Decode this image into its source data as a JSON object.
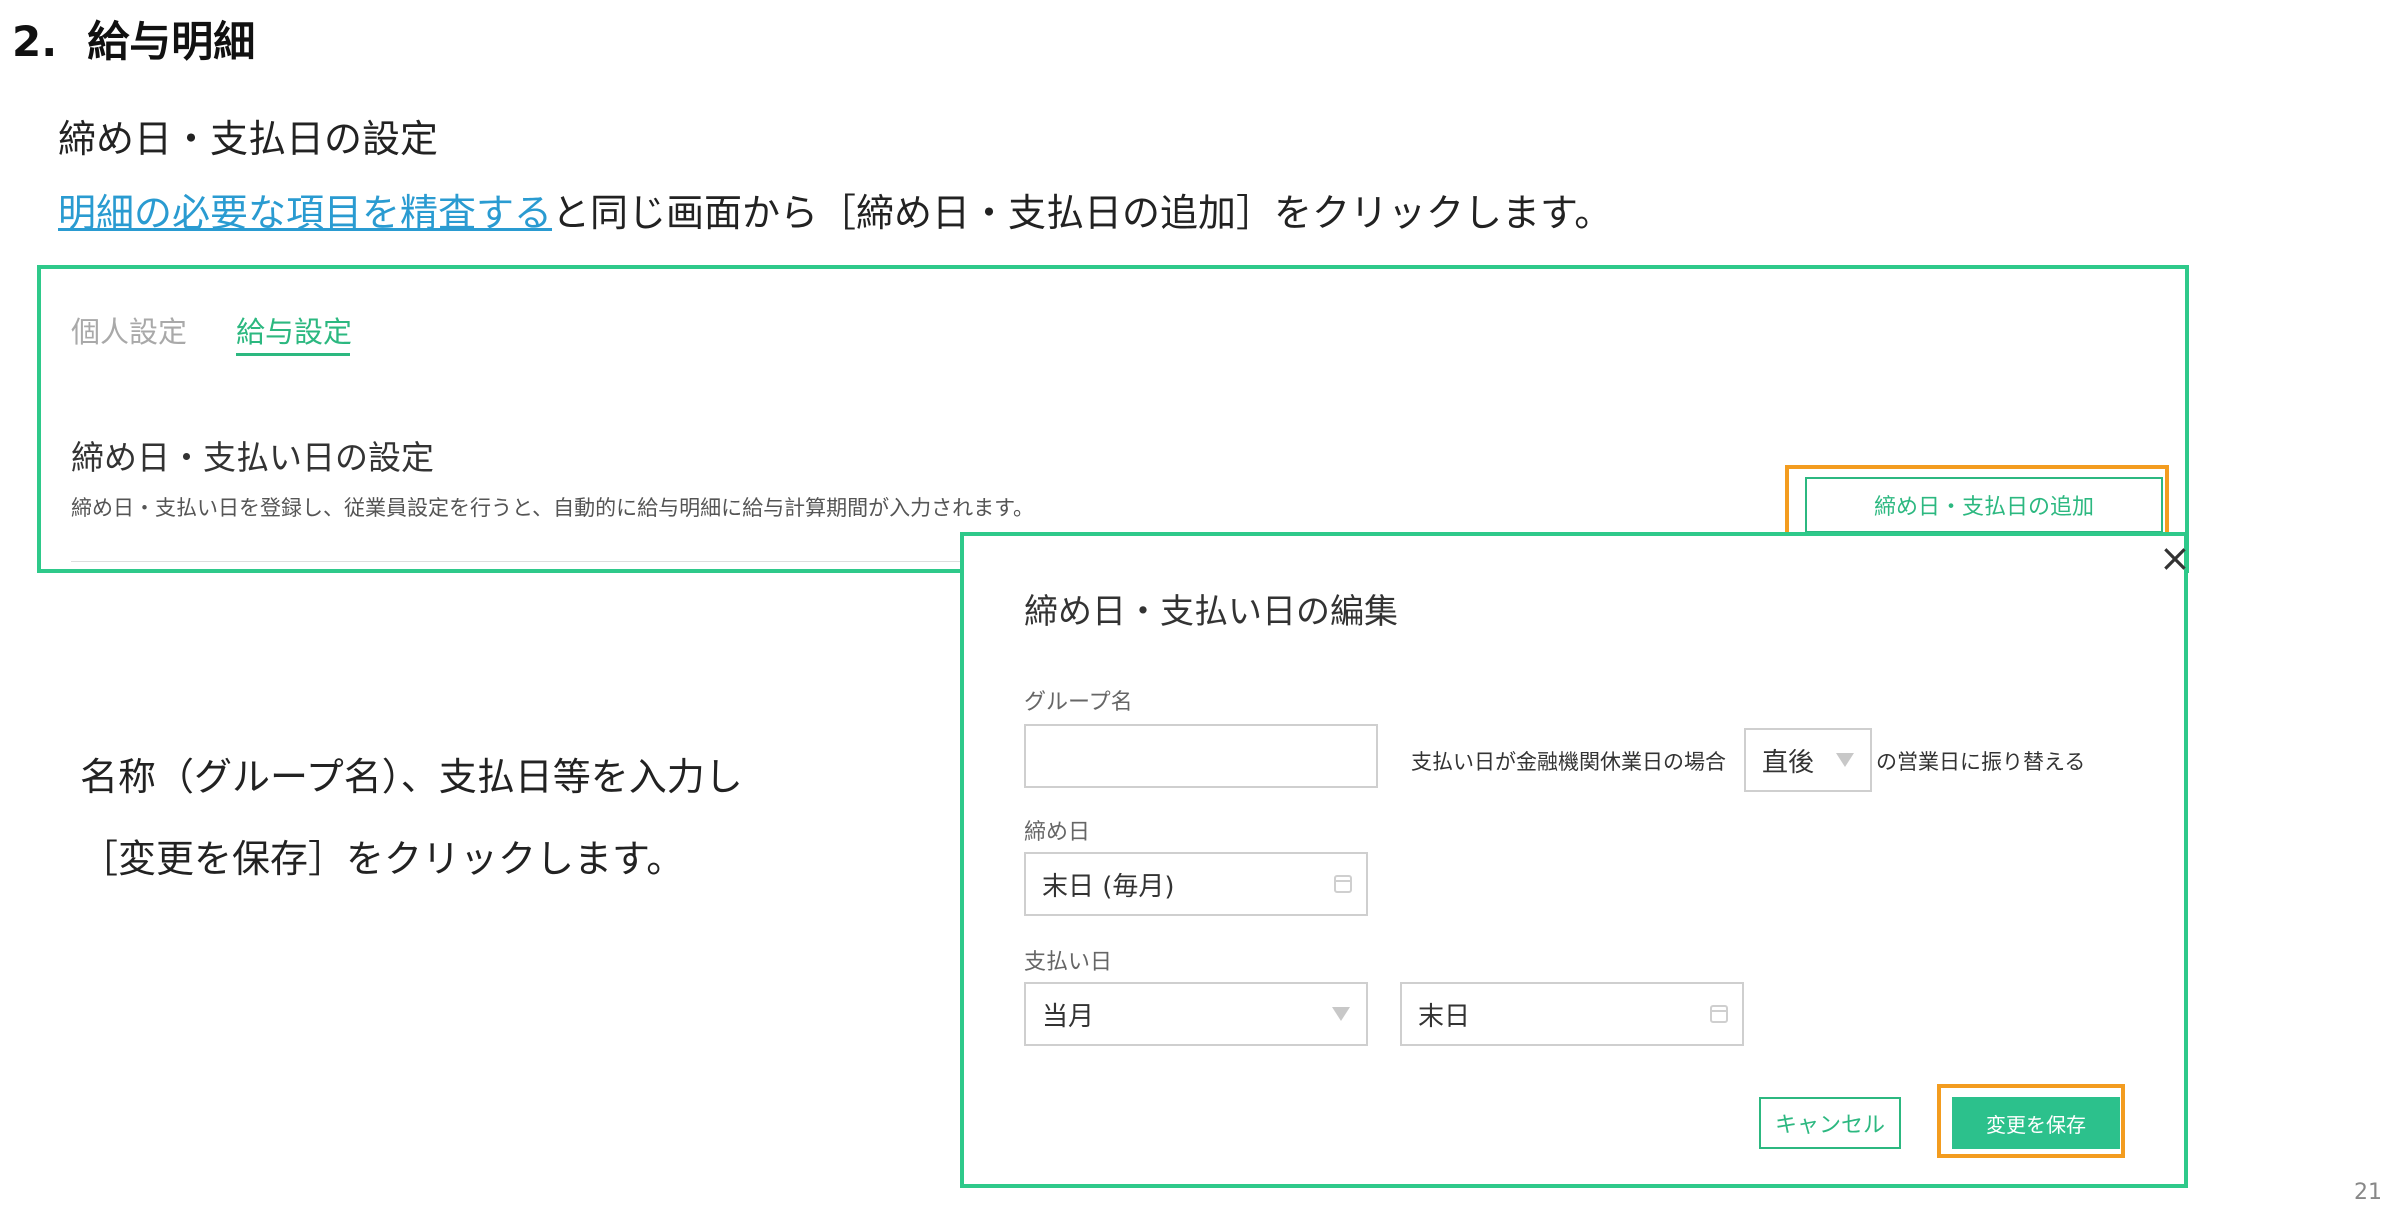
{
  "heading": {
    "number": "2.",
    "title": "給与明細"
  },
  "subheading": "締め日・支払日の設定",
  "instruction": {
    "link_text": "明細の必要な項目を精査する",
    "rest": "と同じ画面から［締め日・支払日の追加］をクリックします。"
  },
  "settings_screen": {
    "tabs": [
      "個人設定",
      "給与設定"
    ],
    "active_tab": "給与設定",
    "section_title": "締め日・支払い日の設定",
    "section_description": "締め日・支払い日を登録し、従業員設定を行うと、自動的に給与明細に給与計算期間が入力されます。",
    "add_button": "締め日・支払日の追加"
  },
  "side_note": {
    "line1": "名称（グループ名）、支払日等を入力し",
    "line2": "［変更を保存］をクリックします。"
  },
  "modal": {
    "close": "×",
    "title": "締め日・支払い日の編集",
    "group_name_label": "グループ名",
    "group_name_value": "",
    "holiday_label": "支払い日が金融機関休業日の場合",
    "holiday_value": "直後",
    "holiday_suffix": "の営業日に振り替える",
    "closing_label": "締め日",
    "closing_value": "末日 (毎月)",
    "payday_label": "支払い日",
    "payday_month_value": "当月",
    "payday_day_value": "末日",
    "cancel_button": "キャンセル",
    "save_button": "変更を保存"
  },
  "page_number": "21",
  "colors": {
    "accent_green": "#2cb880",
    "highlight_orange": "#f39c1f",
    "link_blue": "#2a9bd1"
  }
}
